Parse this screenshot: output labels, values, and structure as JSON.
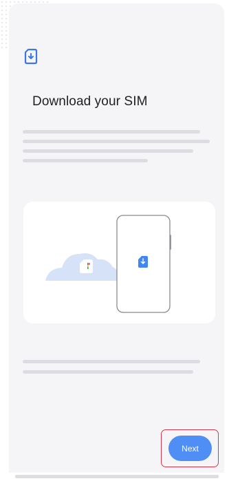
{
  "title": "Download your SIM",
  "icons": {
    "header": "sim-download-icon",
    "illustration_sim": "sim-card-icon",
    "illustration_download": "download-arrow-icon"
  },
  "next_button": {
    "label": "Next"
  },
  "colors": {
    "accent": "#4f8ff5",
    "highlight": "#d9354a",
    "screen_background": "#f5f5f7",
    "card_background": "#ffffff",
    "text_primary": "#202124",
    "placeholder": "#dcdce2",
    "cloud": "#d6e2f7"
  }
}
